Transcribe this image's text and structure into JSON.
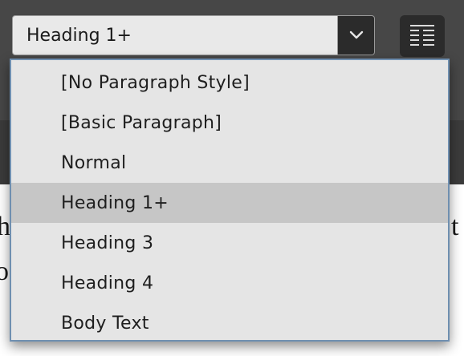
{
  "style_selector": {
    "value": "Heading 1+",
    "arrow_icon": "chevron-down-icon"
  },
  "panel_button": {
    "icon": "paragraph-panel-icon"
  },
  "dropdown": {
    "items": [
      {
        "label": "[No Paragraph Style]",
        "selected": false
      },
      {
        "label": "[Basic Paragraph]",
        "selected": false
      },
      {
        "label": "Normal",
        "selected": false
      },
      {
        "label": "Heading 1+",
        "selected": true
      },
      {
        "label": "Heading 3",
        "selected": false
      },
      {
        "label": "Heading 4",
        "selected": false
      },
      {
        "label": "Body Text",
        "selected": false
      }
    ]
  },
  "document": {
    "left_glyph_1": "h",
    "left_glyph_2": "o",
    "right_glyph": "t"
  },
  "colors": {
    "accent_border": "#6f8fb0",
    "selected_row": "#c6c6c6"
  }
}
